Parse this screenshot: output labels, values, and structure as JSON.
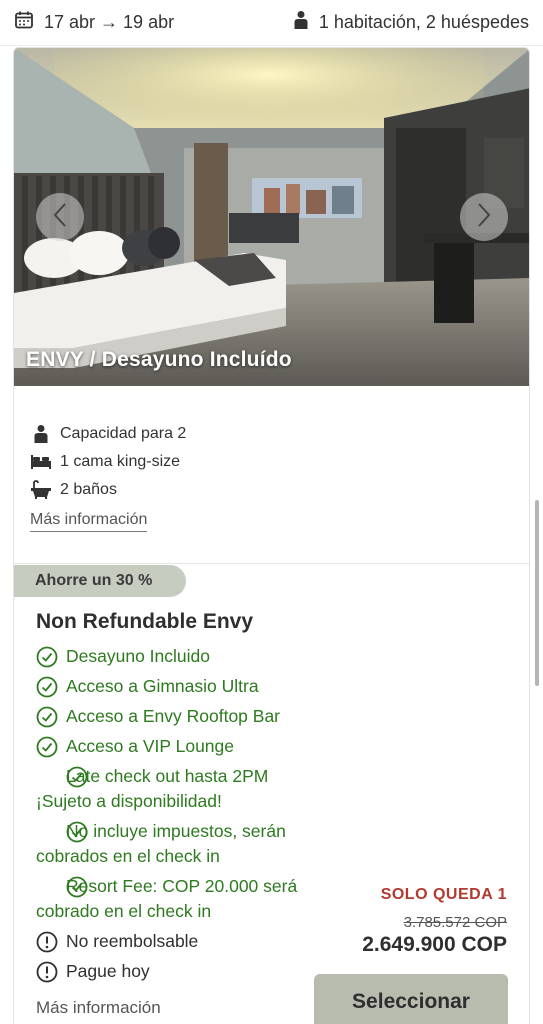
{
  "header": {
    "dates": "17 abr → 19 abr",
    "dates_icon": "calendar-icon",
    "guests": "1 habitación, 2 huéspedes",
    "guests_icon": "person-icon"
  },
  "room": {
    "name": "ENVY / Desayuno Incluído",
    "features": [
      {
        "icon": "person-icon",
        "label": "Capacidad para 2"
      },
      {
        "icon": "bed-icon",
        "label": "1 cama king-size"
      },
      {
        "icon": "bathtub-icon",
        "label": "2 baños"
      }
    ],
    "more_info": "Más información"
  },
  "rate": {
    "savings_badge": "Ahorre un 30 %",
    "title": "Non Refundable Envy",
    "benefits": [
      {
        "icon": "check-circle-icon",
        "text": "Desayuno Incluido",
        "type": "included"
      },
      {
        "icon": "check-circle-icon",
        "text": "Acceso a Gimnasio Ultra",
        "type": "included"
      },
      {
        "icon": "check-circle-icon",
        "text": "Acceso a Envy Rooftop Bar",
        "type": "included"
      },
      {
        "icon": "check-circle-icon",
        "text": "Acceso a VIP Lounge",
        "type": "included"
      },
      {
        "icon": "check-circle-icon",
        "text": "Late check out hasta 2PM ¡Sujeto a disponibilidad!",
        "type": "included"
      },
      {
        "icon": "check-circle-icon",
        "text": "No incluye impuestos, serán cobrados en el check in",
        "type": "included"
      },
      {
        "icon": "check-circle-icon",
        "text": "Resort Fee: COP 20.000 será cobrado en el check in",
        "type": "included"
      },
      {
        "icon": "info-circle-icon",
        "text": "No reembolsable",
        "type": "info"
      },
      {
        "icon": "info-circle-icon",
        "text": "Pague hoy",
        "type": "info"
      }
    ],
    "more_info": "Más información",
    "availability": "SOLO QUEDA 1",
    "old_price": "3.785.572 COP",
    "price": "2.649.900 COP",
    "select_label": "Seleccionar"
  },
  "colors": {
    "included_green": "#2d7a1f",
    "alert_red": "#b23a2f",
    "badge_bg": "#c7ccc0",
    "button_bg": "#b8bcae"
  }
}
